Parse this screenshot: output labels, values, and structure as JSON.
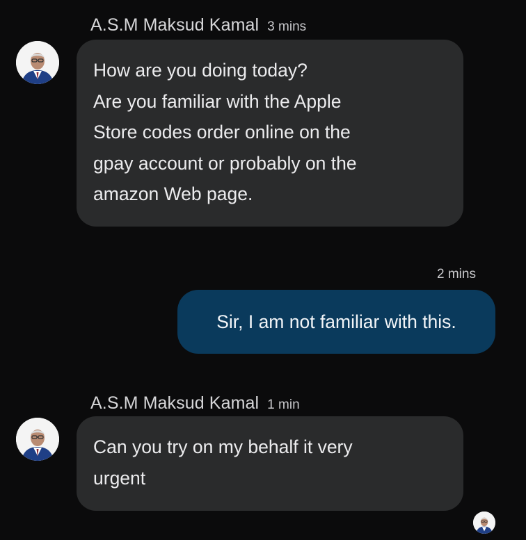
{
  "messages": [
    {
      "direction": "incoming",
      "sender": "A.S.M Maksud Kamal",
      "time": "3 mins",
      "text": "How are you doing today?\nAre you familiar with the Apple\nStore codes order online on the\ngpay account or probably on the\namazon Web page."
    },
    {
      "direction": "outgoing",
      "time": "2 mins",
      "text": "Sir, I am not familiar with this."
    },
    {
      "direction": "incoming",
      "sender": "A.S.M Maksud Kamal",
      "time": "1 min",
      "text": "Can you try on my behalf it very\nurgent"
    }
  ],
  "icons": {
    "sender_avatar": "avatar-icon",
    "read_receipt": "read-receipt-avatar-icon"
  },
  "colors": {
    "background": "#0b0b0c",
    "incoming_bubble": "#2a2b2c",
    "outgoing_bubble": "#0a3a5c"
  }
}
